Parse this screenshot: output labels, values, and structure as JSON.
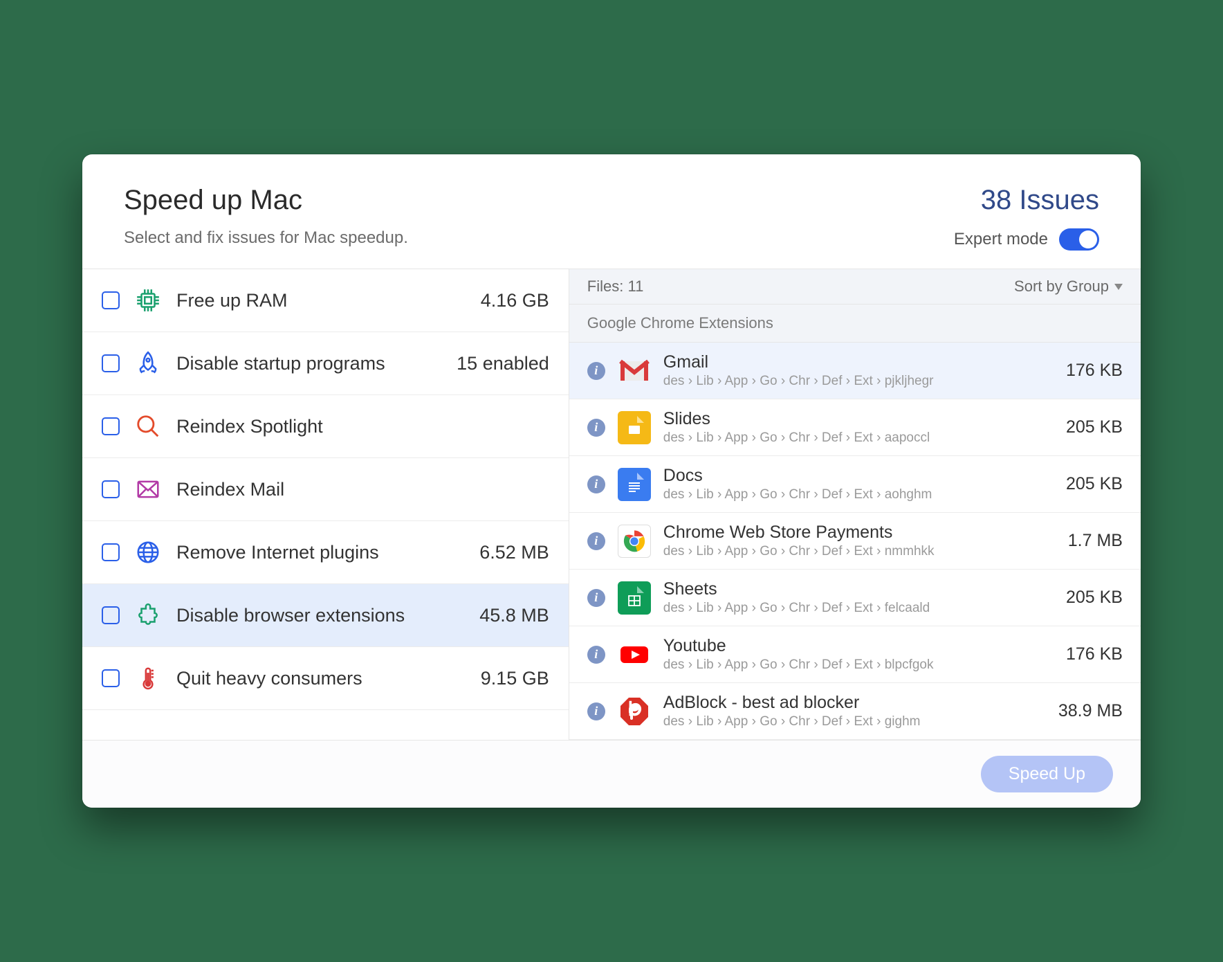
{
  "header": {
    "title": "Speed up Mac",
    "subtitle": "Select and fix issues for Mac speedup.",
    "issues": "38 Issues",
    "expert_label": "Expert mode"
  },
  "categories": [
    {
      "icon": "chip-icon",
      "label": "Free up RAM",
      "value": "4.16 GB",
      "color": "#1aa06e"
    },
    {
      "icon": "rocket-icon",
      "label": "Disable startup programs",
      "value": "15 enabled",
      "color": "#2a5fe8"
    },
    {
      "icon": "search-icon",
      "label": "Reindex Spotlight",
      "value": "",
      "color": "#e34b2b"
    },
    {
      "icon": "mail-icon",
      "label": "Reindex Mail",
      "value": "",
      "color": "#b23aa6"
    },
    {
      "icon": "globe-icon",
      "label": "Remove Internet plugins",
      "value": "6.52 MB",
      "color": "#2a5fe8"
    },
    {
      "icon": "puzzle-icon",
      "label": "Disable browser extensions",
      "value": "45.8 MB",
      "color": "#1aa06e"
    },
    {
      "icon": "thermo-icon",
      "label": "Quit heavy consumers",
      "value": "9.15 GB",
      "color": "#d93a3a"
    }
  ],
  "files_header": {
    "count": "Files: 11",
    "sort": "Sort by Group"
  },
  "group_header": "Google Chrome Extensions",
  "files": [
    {
      "name": "Gmail",
      "path": "des › Lib › App › Go › Chr › Def › Ext › pjkljhegr",
      "size": "176 KB",
      "icon": "gmail"
    },
    {
      "name": "Slides",
      "path": "des › Lib › App › Go › Chr › Def › Ext › aapoccl",
      "size": "205 KB",
      "icon": "slides"
    },
    {
      "name": "Docs",
      "path": "des › Lib › App › Go › Chr › Def › Ext › aohghm",
      "size": "205 KB",
      "icon": "docs"
    },
    {
      "name": "Chrome Web Store Payments",
      "path": "des › Lib › App › Go › Chr › Def › Ext › nmmhkk",
      "size": "1.7 MB",
      "icon": "chrome"
    },
    {
      "name": "Sheets",
      "path": "des › Lib › App › Go › Chr › Def › Ext › felcaald",
      "size": "205 KB",
      "icon": "sheets"
    },
    {
      "name": "Youtube",
      "path": "des › Lib › App › Go › Chr › Def › Ext › blpcfgok",
      "size": "176 KB",
      "icon": "youtube"
    },
    {
      "name": "AdBlock - best ad blocker",
      "path": "des › Lib › App › Go › Chr › Def › Ext › gighm",
      "size": "38.9 MB",
      "icon": "adblock"
    }
  ],
  "footer": {
    "button": "Speed Up"
  }
}
